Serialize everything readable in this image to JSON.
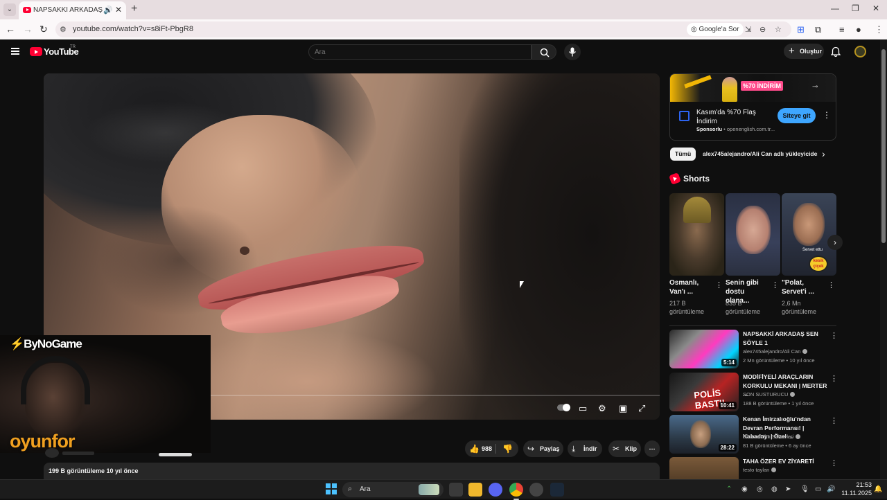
{
  "browser": {
    "tab_title": "NAPSAKKİ ARKADAŞ SEN S",
    "url": "youtube.com/watch?v=s8iFt-PbgR8",
    "ask_google_label": "Google'a Sor",
    "icons": [
      "menu-chevron-icon",
      "youtube-favicon",
      "speaker-icon",
      "close-icon",
      "plus-icon",
      "back-icon",
      "forward-icon",
      "reload-icon",
      "site-settings-icon",
      "install-icon",
      "zoom-icon",
      "star-icon",
      "translate-icon",
      "extensions-icon",
      "reading-list-icon",
      "profile-icon",
      "more-icon",
      "minimize-icon",
      "restore-icon",
      "close-window-icon"
    ]
  },
  "youtube": {
    "logo_text": "YouTube",
    "region": "TR",
    "search_placeholder": "Ara",
    "create_label": "Oluştur",
    "icons": [
      "hamburger-icon",
      "search-icon",
      "mic-icon",
      "plus-icon",
      "bell-icon",
      "avatar"
    ]
  },
  "video": {
    "likes": "988",
    "share_label": "Paylaş",
    "download_label": "İndir",
    "clip_label": "Klip",
    "description_meta": "199 B görüntüleme  10 yıl önce",
    "progress": 0,
    "overlay": {
      "brand": "ByNoGame",
      "sponsor": "oyunfor"
    }
  },
  "ad": {
    "banner_badge": "%70 İNDİRİM",
    "title": "Kasım'da %70 Flaş İndirim",
    "sponsor_label": "Sponsorlu",
    "sponsor_domain": "openenglish.com.tr...",
    "cta": "Siteye git"
  },
  "chips": [
    "Tümü",
    "alex745alejandro/Ali Can adlı yükleyiciden"
  ],
  "shorts": {
    "title": "Shorts",
    "items": [
      {
        "title": "Osmanlı, Van'ı ...",
        "views": "217 B görüntüleme"
      },
      {
        "title": "Senin gibi dostu olana...",
        "views": "835 B görüntüleme"
      },
      {
        "title": "\"Polat, Servet'i ...",
        "views": "2,6 Mn görüntüleme",
        "sticker_caption": "Servet ettu",
        "sticker_word": "kesik çiçek"
      }
    ]
  },
  "recommendations": [
    {
      "title": "NAPSAKKİ ARKADAŞ SEN SÖYLE 1",
      "channel": "alex745alejandro/Ali Can",
      "verified": true,
      "meta": "2 Mn görüntüleme • 10 yıl önce",
      "duration": "5:14"
    },
    {
      "title": "MODİFİYELİ ARAÇLARIN KORKULU MEKANI | MERTER ...",
      "channel": "SON SUSTURUCU",
      "verified": true,
      "meta": "188 B görüntüleme • 1 yıl önce",
      "duration": "10:41",
      "thumb_text": "POLİS BASTI!"
    },
    {
      "title": "Kenan İmirzalıoğlu'ndan Devran Performansı! | Kabadayı | Özel ...",
      "channel": "Efsane Film Sahneleri",
      "verified": true,
      "meta": "81 B görüntüleme • 6 ay önce",
      "duration": "28:22"
    },
    {
      "title": "TAHA ÖZER EV ZİYARETİ",
      "channel": "testo taylan",
      "verified": true,
      "meta": "",
      "duration": ""
    }
  ],
  "taskbar": {
    "search_label": "Ara",
    "time": "21:53",
    "date": "11.11.2025",
    "apps": [
      "windows-start-icon",
      "task-view-icon",
      "file-explorer-icon",
      "discord-icon",
      "chrome-icon",
      "notification-app-icon",
      "steam-icon"
    ]
  }
}
